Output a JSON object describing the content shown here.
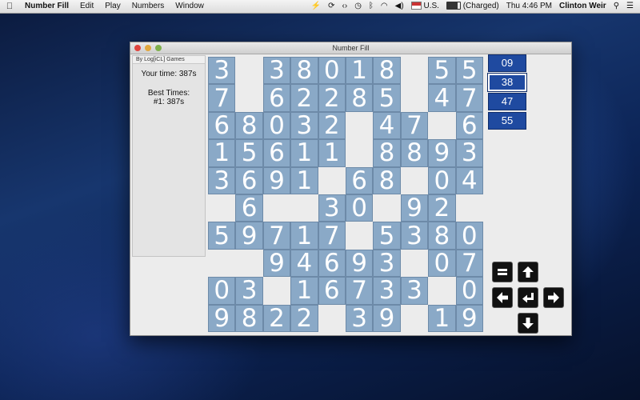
{
  "menubar": {
    "apple": "",
    "app_name": "Number Fill",
    "menus": [
      "Edit",
      "Play",
      "Numbers",
      "Window"
    ],
    "keyboard_region": "U.S.",
    "battery_status": "(Charged)",
    "clock": "Thu 4:46 PM",
    "user": "Clinton Weir"
  },
  "window": {
    "title": "Number Fill"
  },
  "sidebar": {
    "credits": "By Log[iCL] Games",
    "your_time": "Your time: 387s",
    "best_times_title": "Best Times:",
    "best_times": [
      "#1: 387s"
    ]
  },
  "grid": [
    [
      "3",
      "",
      "3",
      "8",
      "0",
      "1",
      "8",
      "",
      "5",
      "5"
    ],
    [
      "7",
      "",
      "6",
      "2",
      "2",
      "8",
      "5",
      "",
      "4",
      "7"
    ],
    [
      "6",
      "8",
      "0",
      "3",
      "2",
      "",
      "4",
      "7",
      "",
      "6"
    ],
    [
      "1",
      "5",
      "6",
      "1",
      "1",
      "",
      "8",
      "8",
      "9",
      "3"
    ],
    [
      "3",
      "6",
      "9",
      "1",
      "",
      "6",
      "8",
      "",
      "0",
      "4"
    ],
    [
      "",
      "6",
      "",
      "",
      "3",
      "0",
      "",
      "9",
      "2",
      ""
    ],
    [
      "5",
      "9",
      "7",
      "1",
      "7",
      "",
      "5",
      "3",
      "8",
      "0"
    ],
    [
      "",
      "",
      "9",
      "4",
      "6",
      "9",
      "3",
      "",
      "0",
      "7"
    ],
    [
      "0",
      "3",
      "",
      "1",
      "6",
      "7",
      "3",
      "3",
      "",
      "0"
    ],
    [
      "9",
      "8",
      "2",
      "2",
      "",
      "3",
      "9",
      "",
      "1",
      "9"
    ]
  ],
  "word_list": {
    "items": [
      "09",
      "38",
      "47",
      "55"
    ],
    "selected_index": 1
  },
  "controls": {
    "buttons": [
      "swap-icon",
      "arrow-up-icon",
      "arrow-left-icon",
      "enter-icon",
      "arrow-right-icon",
      "arrow-down-icon"
    ]
  }
}
